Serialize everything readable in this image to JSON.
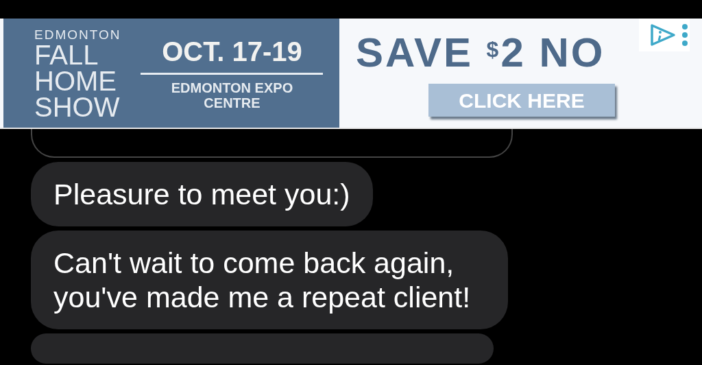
{
  "ad": {
    "brand_lines": [
      "EDMONTON",
      "FALL",
      "HOME",
      "SHOW"
    ],
    "dates": "OCT. 17-19",
    "venue": "EDMONTON EXPO CENTRE",
    "headline": {
      "before": "SAVE",
      "currency": "$",
      "after": "2 NO"
    },
    "button": "CLICK HERE"
  },
  "messages": [
    {
      "kind": "outlined"
    },
    {
      "kind": "received",
      "text": "Pleasure to meet you:)"
    },
    {
      "kind": "received",
      "text": "Can't wait to come back again, you've made me a repeat client!"
    },
    {
      "kind": "received"
    }
  ]
}
